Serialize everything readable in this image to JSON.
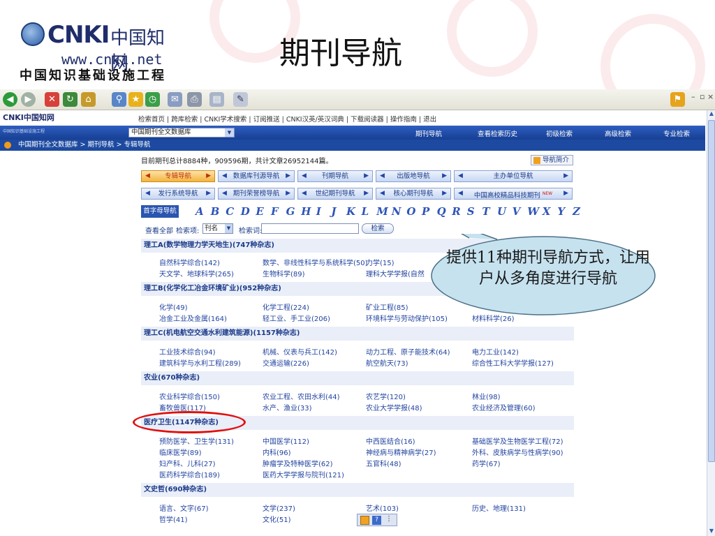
{
  "slide": {
    "logo": {
      "brand": "CNKI",
      "chinese": "中国知网",
      "url": "www.cnki.net",
      "full_name": "中国知识基础设施工程"
    },
    "title": "期刊导航"
  },
  "browser": {
    "toolbar_icons": [
      "back-icon",
      "forward-icon",
      "stop-icon",
      "refresh-icon",
      "home-icon",
      "search-icon",
      "favorites-icon",
      "history-icon",
      "mail-icon",
      "print-icon",
      "edit-icon",
      "discuss-icon"
    ]
  },
  "site": {
    "mini_logo": "CNKI中国知网",
    "mini_url": "www.cnki.net",
    "subtitle": "中国知识基础设施工程",
    "topnav": [
      "检索首页",
      "跨库检索",
      "CNKI学术搜索",
      "订阅推送",
      "CNKI汉英/英汉词典",
      "下载阅读器",
      "操作指南",
      "退出"
    ],
    "db_select": "中国期刊全文数据库",
    "navtabs": [
      "期刊导航",
      "查看检索历史",
      "初级检索",
      "高级检索",
      "专业检索"
    ],
    "breadcrumb": "中国期刊全文数据库 > 期刊导航 > 专辑导航"
  },
  "summary": "目前期刊总计8884种，909596期，共计文章26952144篇。",
  "intro_button": "导航简介",
  "nav_row1": [
    {
      "label": "专辑导航",
      "active": true
    },
    {
      "label": "数据库刊源导航",
      "active": false
    },
    {
      "label": "刊期导航",
      "active": false
    },
    {
      "label": "出版地导航",
      "active": false
    },
    {
      "label": "主办单位导航",
      "active": false
    }
  ],
  "nav_row2": [
    {
      "label": "发行系统导航",
      "active": false
    },
    {
      "label": "期刊荣誉榜导航",
      "active": false
    },
    {
      "label": "世纪期刊导航",
      "active": false
    },
    {
      "label": "核心期刊导航",
      "active": false
    },
    {
      "label": "中国高校精品科技期刊",
      "badge": "NEW",
      "active": false
    }
  ],
  "letters": {
    "label": "首字母导航",
    "items": [
      "A",
      "B",
      "C",
      "D",
      "E",
      "F",
      "G",
      "H",
      "I",
      "J",
      "K",
      "L",
      "M",
      "N",
      "O",
      "P",
      "Q",
      "R",
      "S",
      "T",
      "U",
      "V",
      "W",
      "X",
      "Y",
      "Z"
    ]
  },
  "search": {
    "view_all": "查看全部",
    "field_label": "检索项:",
    "field_value": "刊名",
    "keyword_label": "检索词:",
    "keyword_value": "",
    "button": "检索"
  },
  "categories": [
    {
      "title": "理工A(数学物理力学天地生)(747种杂志)",
      "subs": [
        "自然科学综合(142)",
        "数学、非线性科学与系统科学(50)",
        "力学(15)",
        "天文学、地球科学(265)",
        "生物科学(89)",
        "理科大学学报(自然"
      ]
    },
    {
      "title": "理工B(化学化工冶金环境矿业)(952种杂志)",
      "subs": [
        "化学(49)",
        "化学工程(224)",
        "矿业工程(85)",
        "冶金工业及金属(164)",
        "轻工业、手工业(206)",
        "环境科学与劳动保护(105)",
        "材料科学(26)"
      ]
    },
    {
      "title": "理工C(机电航空交通水利建筑能源)(1157种杂志)",
      "subs": [
        "工业技术综合(94)",
        "机械、仪表与兵工(142)",
        "动力工程、原子能技术(64)",
        "电力工业(142)",
        "建筑科学与水利工程(289)",
        "交通运输(226)",
        "航空航天(73)",
        "综合性工科大学学报(127)"
      ]
    },
    {
      "title": "农业(670种杂志)",
      "subs": [
        "农业科学综合(150)",
        "农业工程、农田水利(44)",
        "农艺学(120)",
        "林业(98)",
        "畜牧兽医(117)",
        "水产、渔业(33)",
        "农业大学学报(48)",
        "农业经济及管理(60)"
      ]
    },
    {
      "title": "医疗卫生(1147种杂志)",
      "subs": [
        "预防医学、卫生学(131)",
        "中国医学(112)",
        "中西医结合(16)",
        "基础医学及生物医学工程(72)",
        "临床医学(89)",
        "内科(96)",
        "神经病与精神病学(27)",
        "外科、皮肤病学与性病学(90)",
        "妇产科、儿科(27)",
        "肿瘤学及特种医学(62)",
        "五官科(48)",
        "药学(67)",
        "医药科学综合(189)",
        "医药大学学报与院刊(121)"
      ]
    },
    {
      "title": "文史哲(690种杂志)",
      "subs": [
        "语言、文字(67)",
        "文学(237)",
        "艺术(103)",
        "历史、地理(131)",
        "哲学(41)",
        "文化(51)"
      ]
    }
  ],
  "callout": "提供11种期刊导航方式，让用户从多角度进行导航"
}
